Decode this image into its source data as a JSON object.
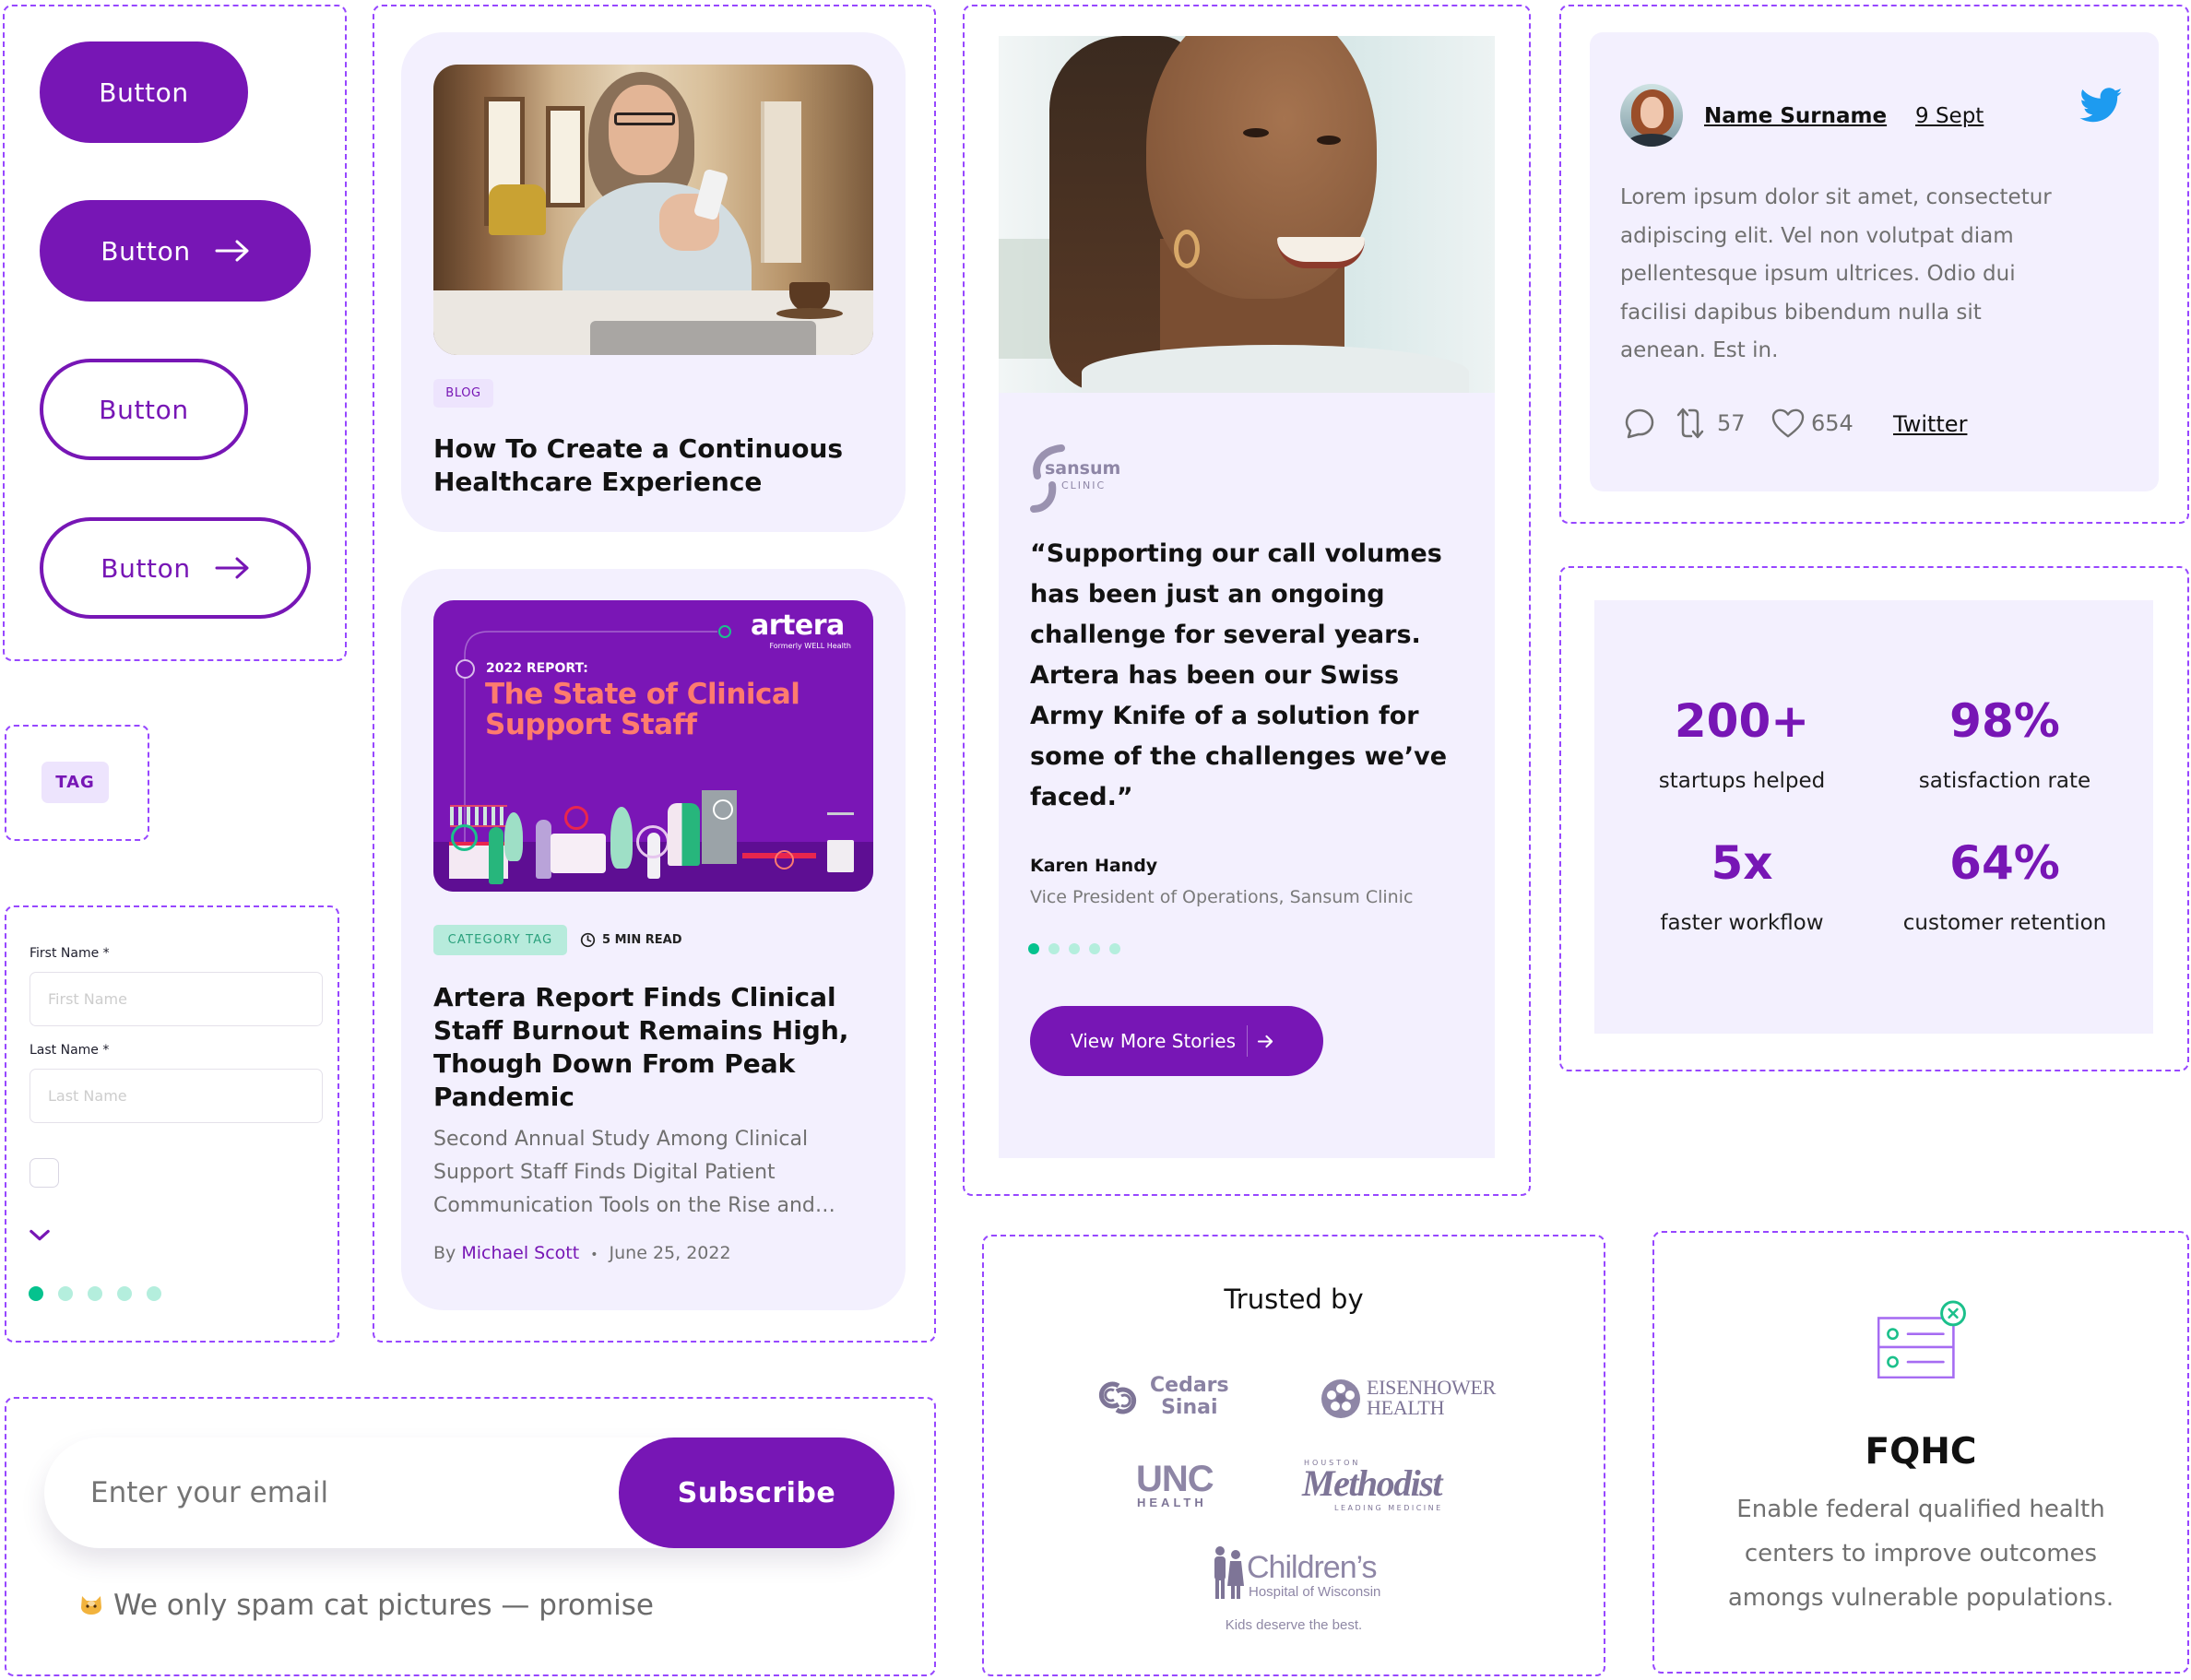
{
  "theme": {
    "primary": "#7716B5",
    "frame_border": "#9747FF",
    "card_bg": "#F3F0FE",
    "tag_bg": "#EDE4FD",
    "accent_green": "#05C28E",
    "accent_green_light": "#B4EEDD",
    "category_tag_bg": "#B7EBDC",
    "category_tag_text": "#2AA07C",
    "twitter_blue": "#1D9BF0",
    "logo_gray": "#7E7597",
    "report_coral": "#FF7B6E"
  },
  "buttons": [
    {
      "label": "Button",
      "style": "filled",
      "trailing_icon": null
    },
    {
      "label": "Button",
      "style": "filled",
      "trailing_icon": "arrow-right-icon"
    },
    {
      "label": "Button",
      "style": "outline",
      "trailing_icon": null
    },
    {
      "label": "Button",
      "style": "outline",
      "trailing_icon": "arrow-right-icon"
    }
  ],
  "tag": {
    "label": "TAG"
  },
  "form": {
    "fields": [
      {
        "label": "First Name *",
        "placeholder": "First Name",
        "value": ""
      },
      {
        "label": "Last Name *",
        "placeholder": "Last Name",
        "value": ""
      }
    ],
    "checkbox": {
      "checked": false
    },
    "dropdown_icon": "chevron-down-icon",
    "pagination": {
      "total": 5,
      "active_index": 0
    }
  },
  "blog_cards": [
    {
      "tag": "BLOG",
      "image": "woman-using-phone-at-table",
      "title_lines": [
        "How To Create a Continuous",
        "Healthcare Experience"
      ]
    },
    {
      "category_tag": "CATEGORY TAG",
      "read_time": "5 MIN READ",
      "image": {
        "brand": "artera",
        "brand_sub": "Formerly WELL Health",
        "kicker": "2022 REPORT:",
        "headline_lines": [
          "The State of Clinical",
          "Support Staff"
        ]
      },
      "title_lines": [
        "Artera Report Finds Clinical",
        "Staff Burnout Remains High,",
        "Though Down From Peak",
        "Pandemic"
      ],
      "excerpt_lines": [
        "Second Annual Study Among Clinical",
        "Support Staff Finds Digital Patient",
        "Communication Tools on the Rise and…"
      ],
      "byline_prefix": "By",
      "author": "Michael Scott",
      "separator": "•",
      "date": "June 25, 2022"
    }
  ],
  "testimonial": {
    "image": "smiling-woman-portrait",
    "logo": {
      "name": "sansum",
      "sub": "CLINIC"
    },
    "quote_lines": [
      "“Supporting our call volumes",
      "has been just an ongoing",
      "challenge for several years.",
      "Artera has been our Swiss",
      "Army Knife of a solution for",
      "some of the challenges we’ve",
      "faced.”"
    ],
    "author": "Karen Handy",
    "role": "Vice President of Operations, Sansum Clinic",
    "pagination": {
      "total": 5,
      "active_index": 0
    },
    "cta": "View More Stories"
  },
  "tweet": {
    "author": "Name Surname",
    "date": "9 Sept",
    "body_lines": [
      "Lorem ipsum dolor sit amet, consectetur",
      "adipiscing elit. Vel non volutpat diam",
      "pellentesque ipsum ultrices. Odio dui",
      "facilisi dapibus bibendum nulla sit",
      "aenean. Est in."
    ],
    "retweets": "57",
    "likes": "654",
    "link": "Twitter"
  },
  "stats": [
    {
      "value": "200+",
      "label": "startups helped"
    },
    {
      "value": "98%",
      "label": "satisfaction rate"
    },
    {
      "value": "5x",
      "label": "faster workflow"
    },
    {
      "value": "64%",
      "label": "customer retention"
    }
  ],
  "newsletter": {
    "email_placeholder": "Enter your email",
    "email_value": "",
    "submit_label": "Subscribe",
    "note": "We only spam cat pictures — promise",
    "note_icon": "cat-face-icon"
  },
  "trusted": {
    "title": "Trusted by",
    "logos": {
      "cedars": [
        "Cedars",
        "Sinai"
      ],
      "eisenhower": [
        "EISENHOWER",
        "HEALTH"
      ],
      "unc": [
        "UNC",
        "HEALTH"
      ],
      "methodist": [
        "HOUSTON",
        "Methodist",
        "LEADING MEDICINE"
      ],
      "childrens": [
        "Children’s",
        "Hospital of Wisconsin"
      ],
      "childrens_tagline": "Kids deserve the best."
    }
  },
  "feature": {
    "title": "FQHC",
    "description_lines": [
      "Enable federal qualified health",
      "centers to improve outcomes",
      "amongs vulnerable populations."
    ]
  }
}
